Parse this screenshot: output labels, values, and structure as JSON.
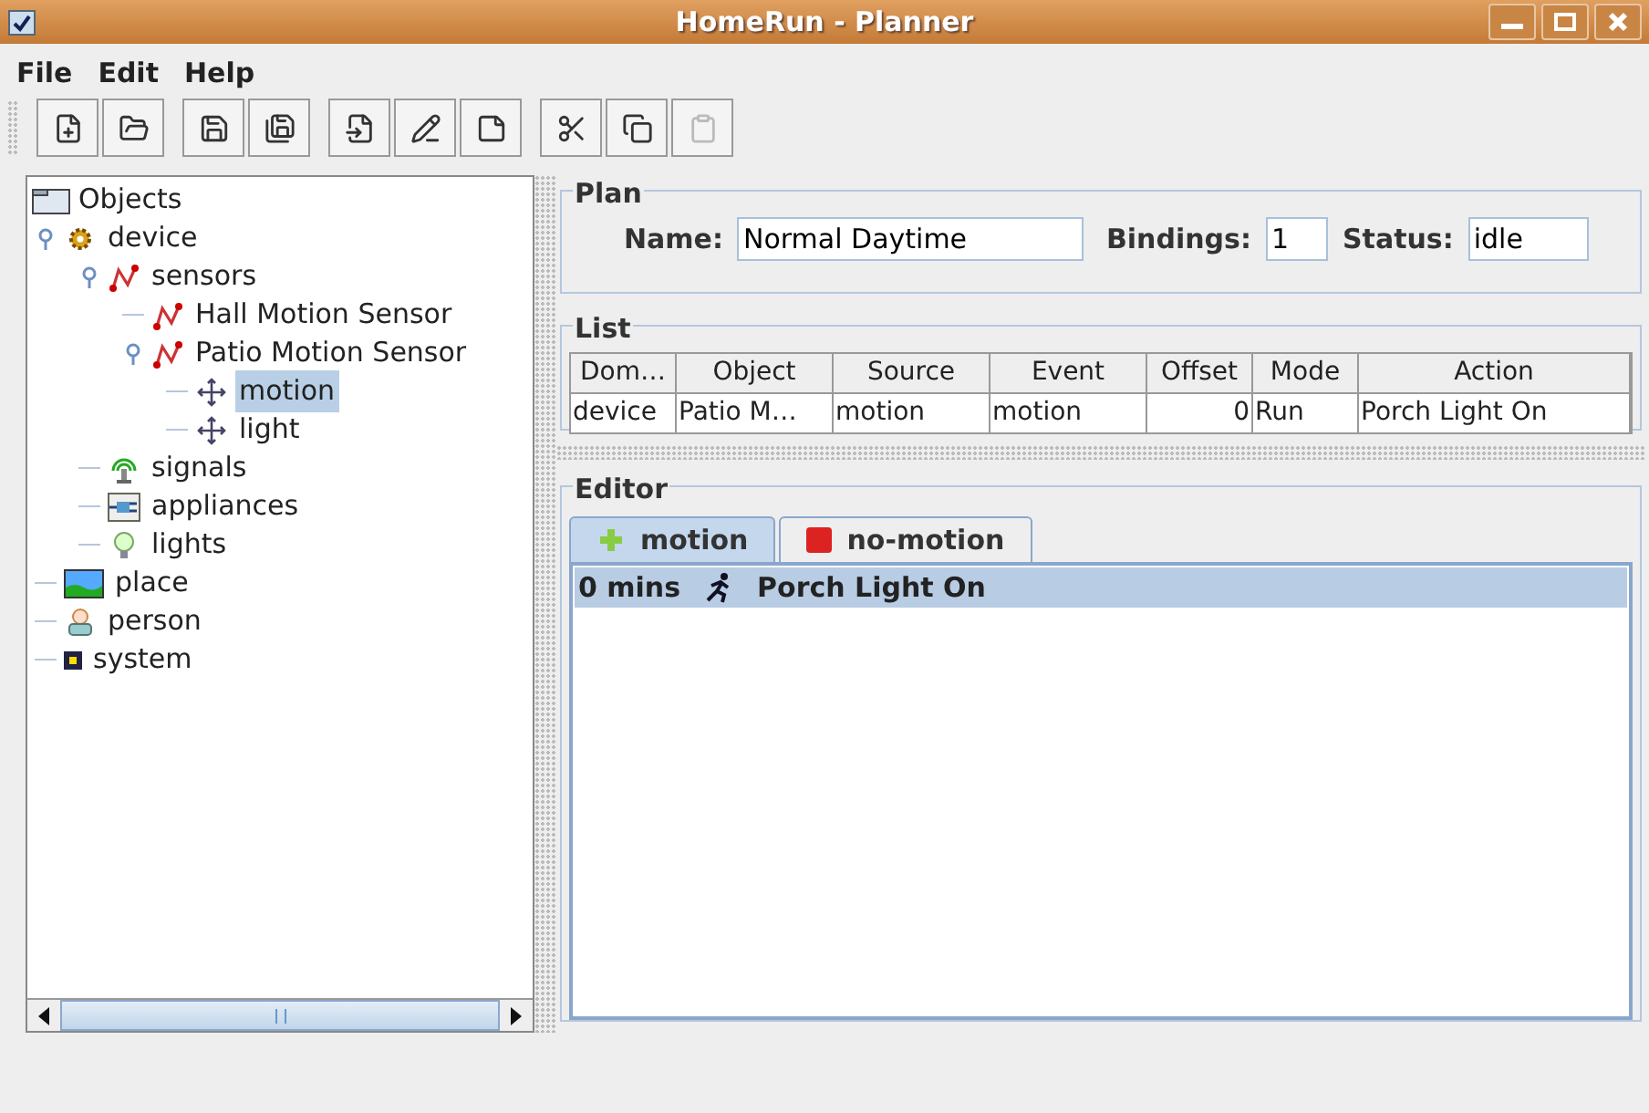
{
  "window": {
    "title": "HomeRun - Planner"
  },
  "menu": [
    "File",
    "Edit",
    "Help"
  ],
  "toolbar": [
    {
      "kind": "new",
      "disabled": false
    },
    {
      "kind": "open",
      "disabled": false
    },
    {
      "kind": "save",
      "disabled": false
    },
    {
      "kind": "saveas",
      "disabled": false
    },
    {
      "kind": "import",
      "disabled": false
    },
    {
      "kind": "edit",
      "disabled": false
    },
    {
      "kind": "note",
      "disabled": false
    },
    {
      "kind": "cut",
      "disabled": false
    },
    {
      "kind": "copy",
      "disabled": false
    },
    {
      "kind": "paste",
      "disabled": true
    }
  ],
  "tree": {
    "label": "Objects",
    "kind": "root",
    "children": [
      {
        "label": "device",
        "kind": "gear",
        "expanded": true,
        "selected": false,
        "children": [
          {
            "label": "sensors",
            "kind": "sensor",
            "expanded": true,
            "selected": false,
            "children": [
              {
                "label": "Hall Motion Sensor",
                "kind": "sensor",
                "selected": false
              },
              {
                "label": "Patio Motion Sensor",
                "kind": "sensor",
                "expanded": true,
                "selected": false,
                "children": [
                  {
                    "label": "motion",
                    "kind": "event",
                    "selected": true
                  },
                  {
                    "label": "light",
                    "kind": "event",
                    "selected": false
                  }
                ]
              }
            ]
          },
          {
            "label": "signals",
            "kind": "signal",
            "selected": false
          },
          {
            "label": "appliances",
            "kind": "appliance",
            "selected": false
          },
          {
            "label": "lights",
            "kind": "bulb",
            "selected": false
          }
        ]
      },
      {
        "label": "place",
        "kind": "landscape",
        "selected": false
      },
      {
        "label": "person",
        "kind": "person",
        "selected": false
      },
      {
        "label": "system",
        "kind": "chip",
        "selected": false
      }
    ]
  },
  "plan": {
    "title": "Plan",
    "name_label": "Name:",
    "name": "Normal Daytime",
    "bindings_label": "Bindings:",
    "bindings": "1",
    "status_label": "Status:",
    "status": "idle"
  },
  "list": {
    "title": "List",
    "columns": [
      "Dom…",
      "Object",
      "Source",
      "Event",
      "Offset",
      "Mode",
      "Action"
    ],
    "rows": [
      [
        "device",
        "Patio M…",
        "motion",
        "motion",
        "0",
        "Run",
        "Porch Light On"
      ]
    ]
  },
  "editor": {
    "title": "Editor",
    "tabs": [
      {
        "label": "motion",
        "kind": "plus",
        "selected": true
      },
      {
        "label": "no-motion",
        "kind": "stop",
        "selected": false
      }
    ],
    "entries": [
      {
        "offset": "0 mins",
        "action": "Porch Light On",
        "selected": true
      }
    ]
  }
}
